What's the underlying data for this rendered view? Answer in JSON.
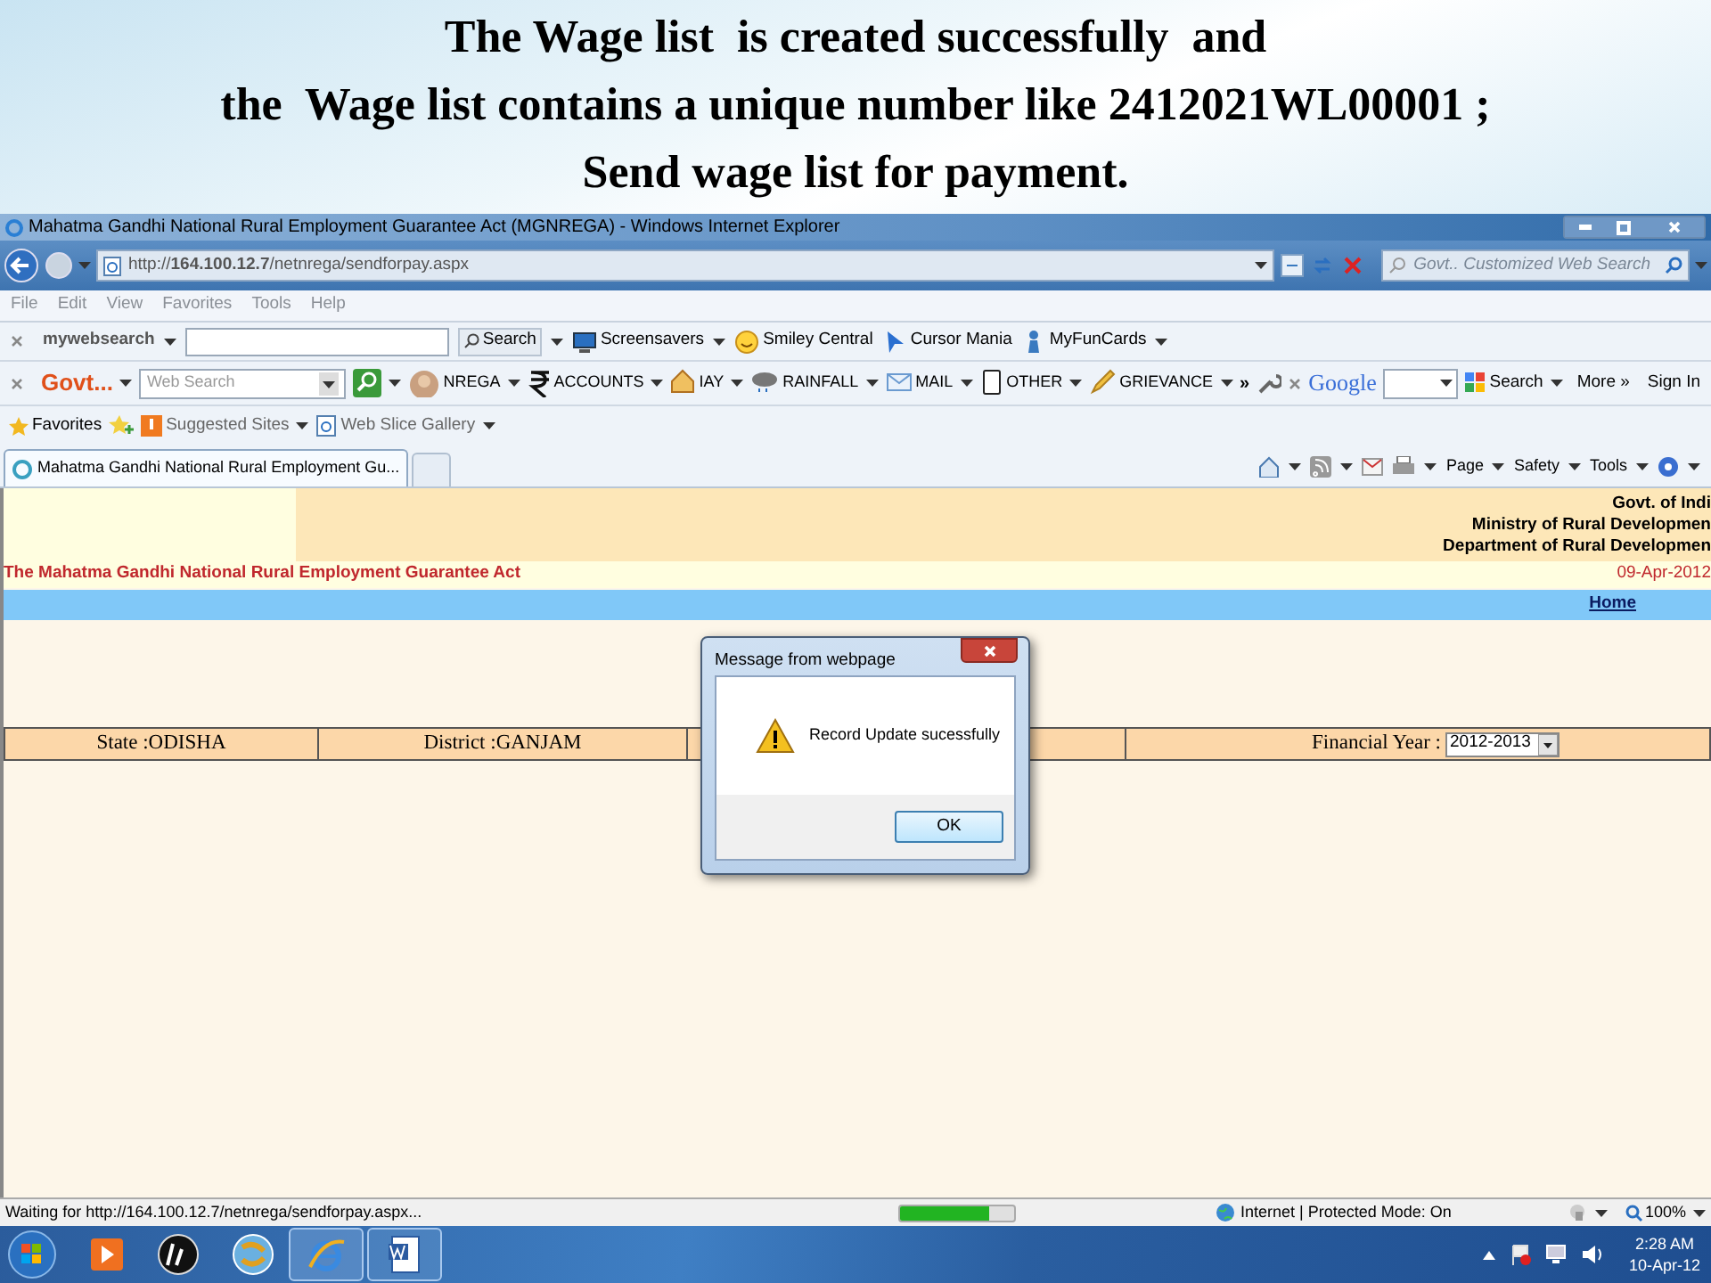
{
  "slide": {
    "title_lines": [
      "The Wage list  is created successfully  and",
      "the  Wage list contains a unique number like 2412021WL00001 ;",
      "Send wage list for payment."
    ]
  },
  "window": {
    "title": "Mahatma Gandhi National Rural Employment Guarantee Act (MGNREGA) - Windows Internet Explorer"
  },
  "address_bar": {
    "url": "http://**164.100.12.7**/netnrega/sendforpay.aspx",
    "search_placeholder": "Govt.. Customized Web Search"
  },
  "menu": [
    "File",
    "Edit",
    "View",
    "Favorites",
    "Tools",
    "Help"
  ],
  "toolbar_1": {
    "brand": "my**websearch**",
    "search_button": "Search",
    "items": [
      "Screensavers",
      "Smiley Central",
      "Cursor Mania",
      "MyFunCards"
    ]
  },
  "toolbar_2": {
    "brand": "Govt...",
    "search_placeholder": "Web Search",
    "items": [
      "NREGA",
      "ACCOUNTS",
      "IAY",
      "RAINFALL",
      "MAIL",
      "OTHER",
      "GRIEVANCE"
    ],
    "more": "»",
    "google": "Google",
    "google_search": "Search",
    "more_link": "More »",
    "sign_in": "Sign In"
  },
  "favorites_bar": {
    "favorites": "Favorites",
    "links": [
      "Suggested Sites",
      "Web Slice Gallery"
    ]
  },
  "tabs": [
    {
      "label": "Mahatma Gandhi National Rural Employment Gu...",
      "selected": true
    }
  ],
  "command_bar": [
    "Page",
    "Safety",
    "Tools"
  ],
  "page": {
    "header_lines": [
      "Govt. of Indi",
      "Ministry of Rural Developmen",
      "Department of Rural Developmen"
    ],
    "act_title": "The Mahatma Gandhi National Rural Employment Guarantee Act",
    "date": "09-Apr-2012",
    "home_link": "Home",
    "state": "State :ODISHA",
    "district": "District :GANJAM",
    "fy_label": "Financial Year :",
    "fy_value": "2012-2013"
  },
  "dialog": {
    "title": "Message from webpage",
    "message": "Record Update sucessfully",
    "ok": "OK"
  },
  "status_bar": {
    "text": "Waiting for http://164.100.12.7/netnrega/sendforpay.aspx...",
    "level": 0.78,
    "zone": "Internet | Protected Mode: On",
    "zoom": "100%"
  },
  "taskbar": {
    "time": "2:28 AM",
    "date": "10-Apr-12"
  }
}
